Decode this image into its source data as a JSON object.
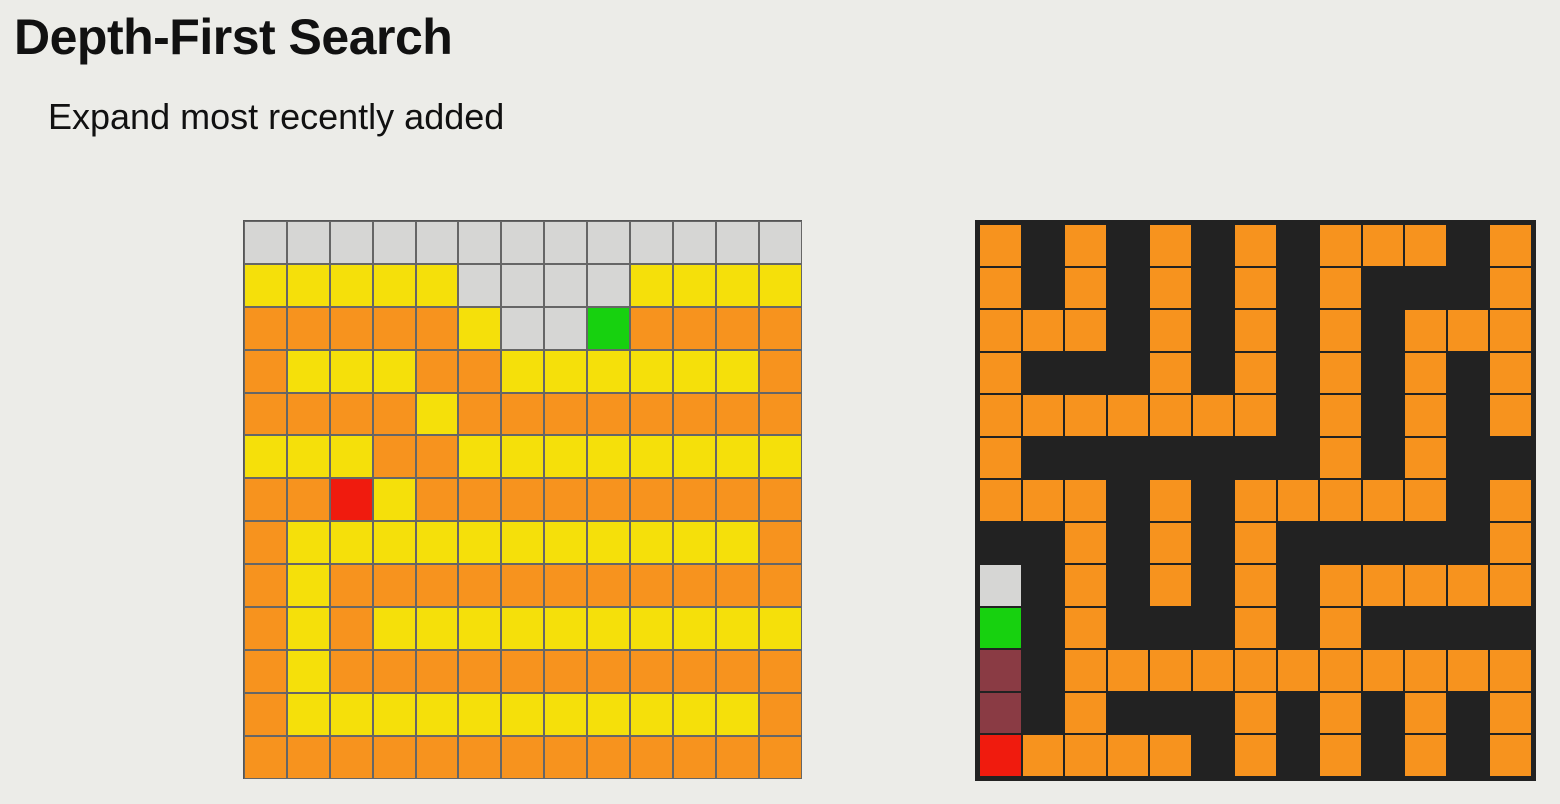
{
  "slide": {
    "title": "Depth-First Search",
    "subtitle": "Expand most recently added"
  },
  "colors": {
    "U": "#d6d6d4",
    "Y": "#f5e00a",
    "O": "#f7931e",
    "G": "#17d10f",
    "R": "#f01b0e",
    "W": "#222222",
    "D": "#8a3b44"
  },
  "left_grid": {
    "rows": [
      "UUUUUUUUUUUUU",
      "YYYYYUUUUYYYY",
      "OOOOOYUUGOOOO",
      "OYYYOOYYYYYYO",
      "OOOOYOOOOOOOO",
      "YYYOOYYYYYYYY",
      "OORYOOOOOOOOO",
      "OYYYYYYYYYYYO",
      "OYOOOOOOOOOOO",
      "OYOYYYYYYYYYY",
      "OYOOOOOOOOOOO",
      "OYYYYYYYYYYYO",
      "OOOOOOOOOOOOO"
    ]
  },
  "right_grid": {
    "rows": [
      "OWOWOWOWOOOWO",
      "OWOWOWOWOWWWO",
      "OOOWOWOWOWOOO",
      "OWWWOWOWOWOWO",
      "OOOOOOOWOWOWO",
      "OWWWWWWWOWOWW",
      "OOOWOWOOOOOWO",
      "WWOWOWOWWWWWO",
      "UWOWOWOWOOOOO",
      "GWOWWWOWOWWWW",
      "DWOOOOOOOOOOO",
      "DWOWWWOWOWOWO",
      "ROOOOWOWOWOWO"
    ]
  }
}
